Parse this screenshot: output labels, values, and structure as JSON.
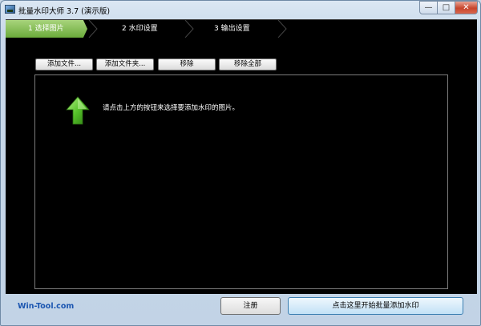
{
  "window": {
    "title": "批量水印大师 3.7 (演示版)",
    "controls": {
      "minimize": "—",
      "maximize": "□",
      "close": "✕"
    }
  },
  "steps": [
    {
      "label": "1 选择图片",
      "active": true
    },
    {
      "label": "2 水印设置",
      "active": false
    },
    {
      "label": "3 输出设置",
      "active": false
    }
  ],
  "toolbar": {
    "add_file": "添加文件...",
    "add_folder": "添加文件夹...",
    "remove": "移除",
    "remove_all": "移除全部"
  },
  "list": {
    "hint": "请点击上方的按钮来选择要添加水印的图片。",
    "icon": "green-up-arrow-icon"
  },
  "footer": {
    "link": "Win-Tool.com",
    "register": "注册",
    "start": "点击这里开始批量添加水印"
  },
  "colors": {
    "accent_green": "#6bab3a",
    "link_blue": "#1a55b0",
    "content_bg": "#000000"
  }
}
